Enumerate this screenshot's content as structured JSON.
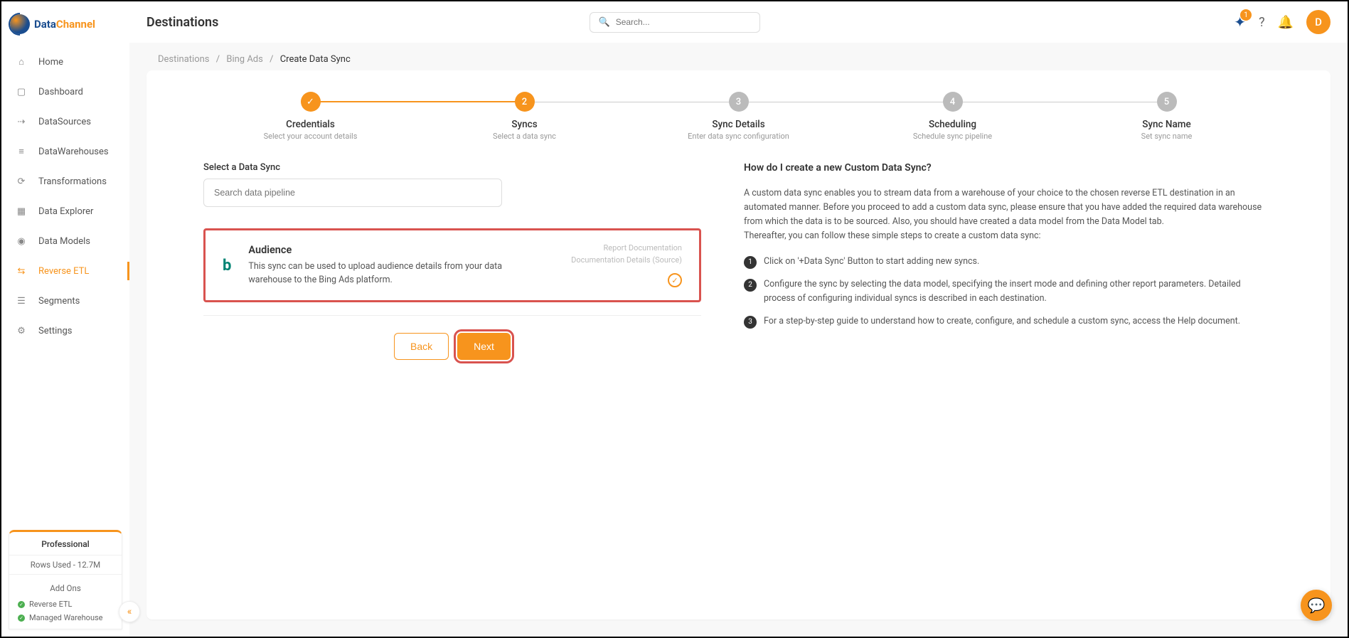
{
  "brand": {
    "name_a": "Data",
    "name_b": "Channel"
  },
  "sidebar": {
    "items": [
      {
        "label": "Home"
      },
      {
        "label": "Dashboard"
      },
      {
        "label": "DataSources"
      },
      {
        "label": "DataWarehouses"
      },
      {
        "label": "Transformations"
      },
      {
        "label": "Data Explorer"
      },
      {
        "label": "Data Models"
      },
      {
        "label": "Reverse ETL"
      },
      {
        "label": "Segments"
      },
      {
        "label": "Settings"
      }
    ],
    "plan": {
      "name": "Professional",
      "rows_used": "Rows Used - 12.7M",
      "addons_heading": "Add Ons",
      "addons": [
        {
          "label": "Reverse ETL"
        },
        {
          "label": "Managed Warehouse"
        }
      ]
    }
  },
  "header": {
    "title": "Destinations",
    "search_placeholder": "Search...",
    "notif_badge": "1",
    "avatar_initial": "D"
  },
  "breadcrumbs": {
    "a": "Destinations",
    "b": "Bing Ads",
    "current": "Create Data Sync"
  },
  "stepper": [
    {
      "title": "Credentials",
      "sub": "Select your account details",
      "state": "done",
      "mark": "✓"
    },
    {
      "title": "Syncs",
      "sub": "Select a data sync",
      "state": "active",
      "mark": "2"
    },
    {
      "title": "Sync Details",
      "sub": "Enter data sync configuration",
      "state": "todo",
      "mark": "3"
    },
    {
      "title": "Scheduling",
      "sub": "Schedule sync pipeline",
      "state": "todo",
      "mark": "4"
    },
    {
      "title": "Sync Name",
      "sub": "Set sync name",
      "state": "todo",
      "mark": "5"
    }
  ],
  "syncs": {
    "section_label": "Select a Data Sync",
    "search_placeholder": "Search data pipeline",
    "card": {
      "title": "Audience",
      "desc": "This sync can be used to upload audience details from your data warehouse to the Bing Ads platform.",
      "link1": "Report Documentation",
      "link2": "Documentation Details (Source)"
    },
    "back_label": "Back",
    "next_label": "Next"
  },
  "help": {
    "heading": "How do I create a new Custom Data Sync?",
    "paragraph": "A custom data sync enables you to stream data from a warehouse of your choice to the chosen reverse ETL destination in an automated manner. Before you proceed to add a custom data sync, please ensure that you have added the required data warehouse from which the data is to be sourced. Also, you should have created a data model from the Data Model tab.\nThereafter, you can follow these simple steps to create a custom data sync:",
    "steps": [
      "Click on '+Data Sync' Button to start adding new syncs.",
      "Configure the sync by selecting the data model, specifying the insert mode and defining other report parameters. Detailed process of configuring individual syncs is described in each destination.",
      "For a step-by-step guide to understand how to create, configure, and schedule a custom sync, access the Help document."
    ]
  }
}
